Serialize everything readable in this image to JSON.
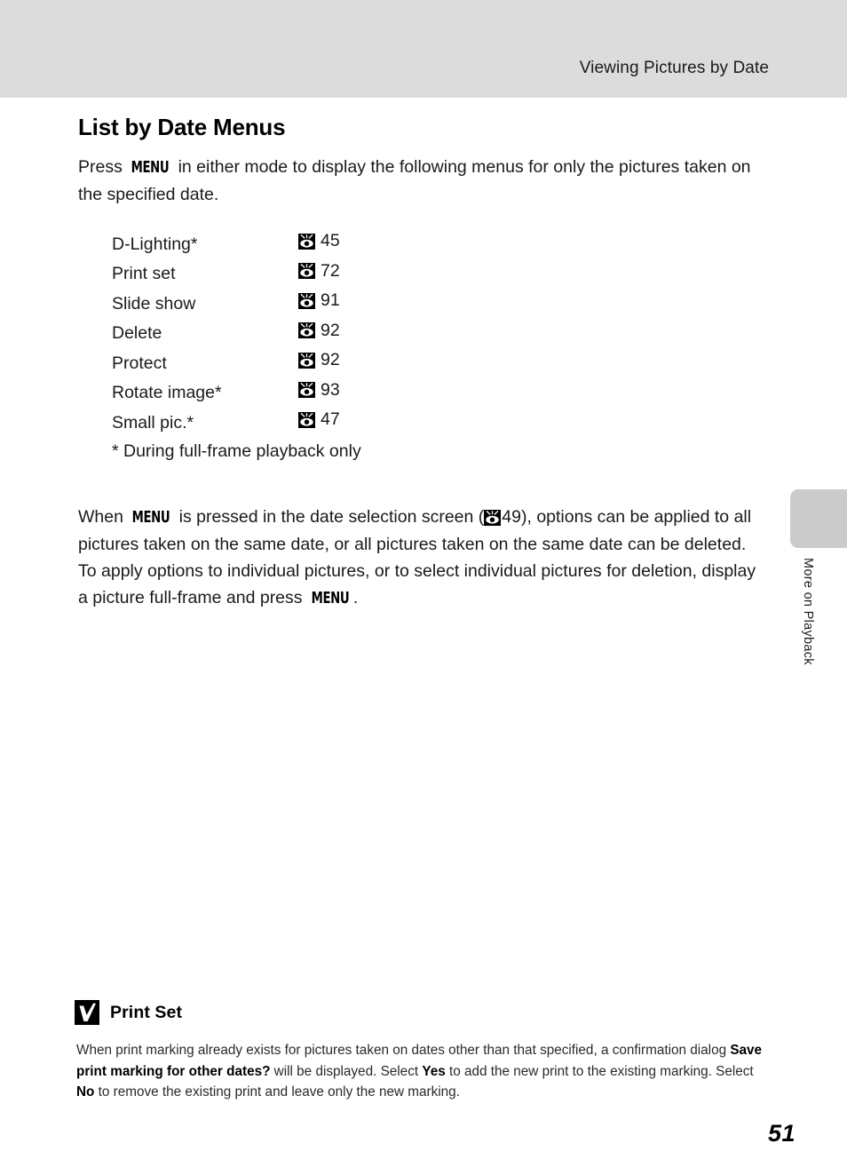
{
  "header": {
    "title": "Viewing Pictures by Date"
  },
  "page": {
    "section_title": "List by Date Menus",
    "number": "51"
  },
  "intro": {
    "before_menu": "Press ",
    "menu_key": "MENU",
    "after_menu": " in either mode to display the following menus for only the pictures taken on the specified date."
  },
  "menu_list": {
    "items": [
      {
        "label": "D-Lighting*",
        "ref_icon": "eye-reference-icon",
        "ref_page": "45"
      },
      {
        "label": "Print set",
        "ref_icon": "eye-reference-icon",
        "ref_page": "72"
      },
      {
        "label": "Slide show",
        "ref_icon": "eye-reference-icon",
        "ref_page": "91"
      },
      {
        "label": "Delete",
        "ref_icon": "eye-reference-icon",
        "ref_page": "92"
      },
      {
        "label": "Protect",
        "ref_icon": "eye-reference-icon",
        "ref_page": "92"
      },
      {
        "label": "Rotate image*",
        "ref_icon": "eye-reference-icon",
        "ref_page": "93"
      },
      {
        "label": "Small pic.*",
        "ref_icon": "eye-reference-icon",
        "ref_page": "47"
      }
    ],
    "footnote": "* During full-frame playback only"
  },
  "body_para": {
    "p1": "When ",
    "menu_key_1": "MENU",
    "p2": " is pressed in the date selection screen (",
    "ref_icon": "eye-reference-icon",
    "ref_page": "49",
    "p3": "), options can be applied to all pictures taken on the same date, or all pictures taken on the same date can be deleted. To apply options to individual pictures, or to select individual pictures for deletion, display a picture full-frame and press ",
    "menu_key_2": "MENU",
    "p4": "."
  },
  "side_tab": {
    "label": "More on Playback"
  },
  "note": {
    "icon": "caution-check-icon",
    "title": "Print Set",
    "t1": "When print marking already exists for pictures taken on dates other than that specified, a confirmation dialog ",
    "b1": "Save print marking for other dates?",
    "t2": " will be displayed. Select ",
    "b2": "Yes",
    "t3": " to add the new print to the existing marking. Select ",
    "b3": "No",
    "t4": " to remove the existing print and leave only the new marking."
  },
  "colors": {
    "header_band": "#dcdcdc",
    "side_tab": "#cbcbcb",
    "text": "#1a1a1a"
  }
}
